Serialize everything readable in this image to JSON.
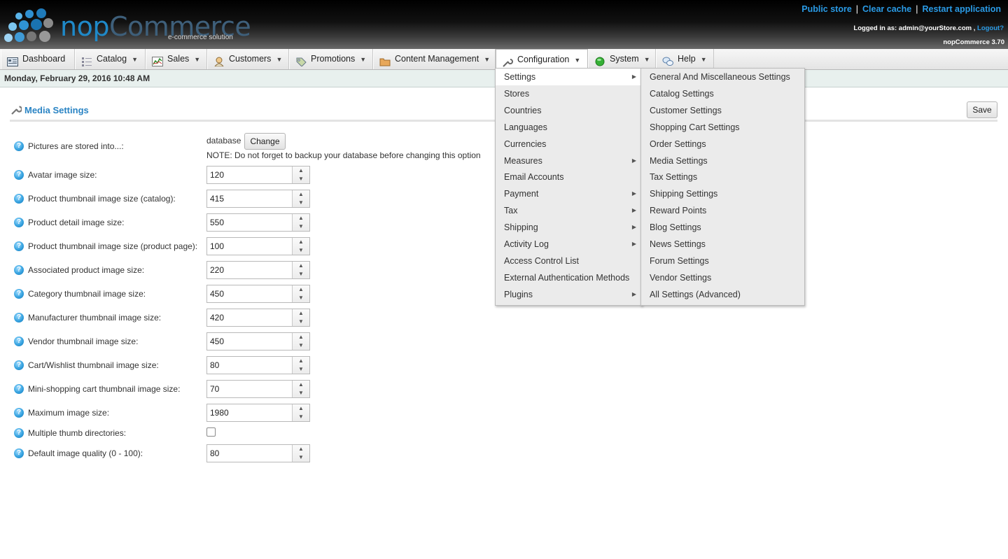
{
  "header": {
    "logo_main": "nop",
    "logo_accent": "Commerce",
    "logo_sub": "e-commerce solution",
    "links": {
      "public_store": "Public store",
      "clear_cache": "Clear cache",
      "restart": "Restart application"
    },
    "logged_in_text": "Logged in as: admin@yourStore.com ,",
    "logout": "Logout?",
    "version": "nopCommerce 3.70"
  },
  "menu": [
    {
      "label": "Dashboard",
      "icon": "dashboard-icon"
    },
    {
      "label": "Catalog",
      "icon": "catalog-icon"
    },
    {
      "label": "Sales",
      "icon": "sales-chart-icon"
    },
    {
      "label": "Customers",
      "icon": "customers-icon"
    },
    {
      "label": "Promotions",
      "icon": "tag-icon"
    },
    {
      "label": "Content Management",
      "icon": "folder-icon"
    },
    {
      "label": "Configuration",
      "icon": "wrench-icon"
    },
    {
      "label": "System",
      "icon": "green-circle-icon"
    },
    {
      "label": "Help",
      "icon": "chat-bubbles-icon"
    }
  ],
  "date_text": "Monday, February 29, 2016 10:48 AM",
  "page": {
    "title": "Media Settings",
    "save_label": "Save"
  },
  "storage": {
    "label": "Pictures are stored into...:",
    "value": "database",
    "change_label": "Change",
    "note": "NOTE: Do not forget to backup your database before changing this option"
  },
  "fields": [
    {
      "label": "Avatar image size:",
      "value": "120"
    },
    {
      "label": "Product thumbnail image size (catalog):",
      "value": "415"
    },
    {
      "label": "Product detail image size:",
      "value": "550"
    },
    {
      "label": "Product thumbnail image size (product page):",
      "value": "100"
    },
    {
      "label": "Associated product image size:",
      "value": "220"
    },
    {
      "label": "Category thumbnail image size:",
      "value": "450"
    },
    {
      "label": "Manufacturer thumbnail image size:",
      "value": "420"
    },
    {
      "label": "Vendor thumbnail image size:",
      "value": "450"
    },
    {
      "label": "Cart/Wishlist thumbnail image size:",
      "value": "80"
    },
    {
      "label": "Mini-shopping cart thumbnail image size:",
      "value": "70"
    },
    {
      "label": "Maximum image size:",
      "value": "1980"
    }
  ],
  "multiple_thumb": {
    "label": "Multiple thumb directories:"
  },
  "quality": {
    "label": "Default image quality (0 - 100):",
    "value": "80"
  },
  "config_menu": [
    {
      "label": "Settings",
      "submenu": true
    },
    {
      "label": "Stores",
      "submenu": false
    },
    {
      "label": "Countries",
      "submenu": false
    },
    {
      "label": "Languages",
      "submenu": false
    },
    {
      "label": "Currencies",
      "submenu": false
    },
    {
      "label": "Measures",
      "submenu": true
    },
    {
      "label": "Email Accounts",
      "submenu": false
    },
    {
      "label": "Payment",
      "submenu": true
    },
    {
      "label": "Tax",
      "submenu": true
    },
    {
      "label": "Shipping",
      "submenu": true
    },
    {
      "label": "Activity Log",
      "submenu": true
    },
    {
      "label": "Access Control List",
      "submenu": false
    },
    {
      "label": "External Authentication Methods",
      "submenu": false
    },
    {
      "label": "Plugins",
      "submenu": true
    }
  ],
  "settings_submenu": [
    "General And Miscellaneous Settings",
    "Catalog Settings",
    "Customer Settings",
    "Shopping Cart Settings",
    "Order Settings",
    "Media Settings",
    "Tax Settings",
    "Shipping Settings",
    "Reward Points",
    "Blog Settings",
    "News Settings",
    "Forum Settings",
    "Vendor Settings",
    "All Settings (Advanced)"
  ],
  "colors": {
    "accent": "#2a84c4",
    "link": "#2a9be6"
  }
}
